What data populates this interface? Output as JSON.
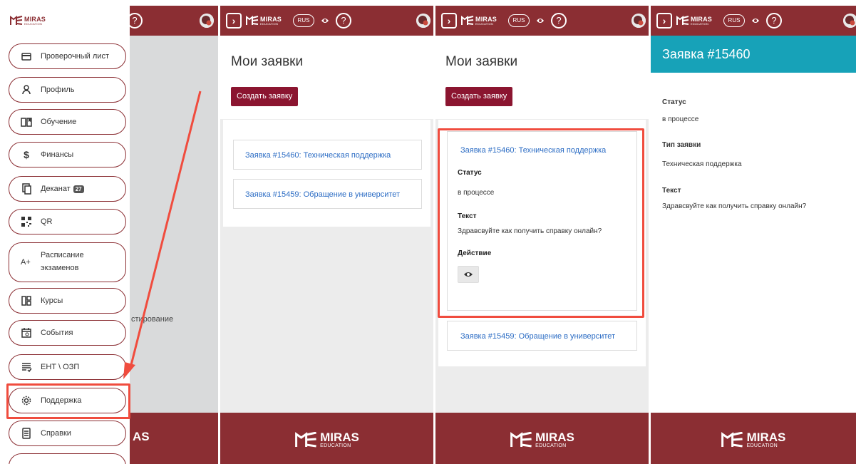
{
  "brand": {
    "word": "MIRAS",
    "sub": "EDUCATION"
  },
  "header": {
    "lang": "RUS",
    "help": "?"
  },
  "colors": {
    "brand": "#8b2e33",
    "primary_btn": "#8b1530",
    "link": "#2b6cc4",
    "info_header": "#17a2b8",
    "highlight": "#f04c3e"
  },
  "sidebar": {
    "items": [
      {
        "label": "Проверочный лист",
        "icon": "card-icon"
      },
      {
        "label": "Профиль",
        "icon": "user-icon"
      },
      {
        "label": "Обучение",
        "icon": "book-icon"
      },
      {
        "label": "Финансы",
        "icon": "dollar-icon"
      },
      {
        "label": "Деканат",
        "icon": "copy-icon",
        "badge": "27"
      },
      {
        "label": "QR",
        "icon": "qr-icon"
      },
      {
        "label": "Расписание экзаменов",
        "line1": "Расписание",
        "line2": "экзаменов",
        "icon": "grade-icon",
        "prefix": "A+"
      },
      {
        "label": "Курсы",
        "icon": "grid-icon"
      },
      {
        "label": "События",
        "icon": "calendar-icon"
      },
      {
        "label": "ЕНТ \\ ОЗП",
        "icon": "checklist-icon"
      },
      {
        "label": "Поддержка",
        "icon": "gear-icon"
      },
      {
        "label": "Справки",
        "icon": "document-icon"
      }
    ],
    "behind_text_fragment": "стирование"
  },
  "requests_page": {
    "title": "Мои заявки",
    "create_button": "Создать заявку",
    "items": [
      {
        "title": "Заявка #15460: Техническая поддержка"
      },
      {
        "title": "Заявка #15459: Обращение в университет"
      }
    ]
  },
  "expanded_request": {
    "title": "Заявка #15460: Техническая поддержка",
    "status_label": "Статус",
    "status_value": "в процессе",
    "text_label": "Текст",
    "text_value": "Здравсвуйте как получить справку онлайн?",
    "action_label": "Действие"
  },
  "request_detail": {
    "header": "Заявка #15460",
    "status_label": "Статус",
    "status_value": "в процессе",
    "type_label": "Тип заявки",
    "type_value": "Техническая поддержка",
    "text_label": "Текст",
    "text_value": "Здравсвуйте как получить справку онлайн?"
  }
}
